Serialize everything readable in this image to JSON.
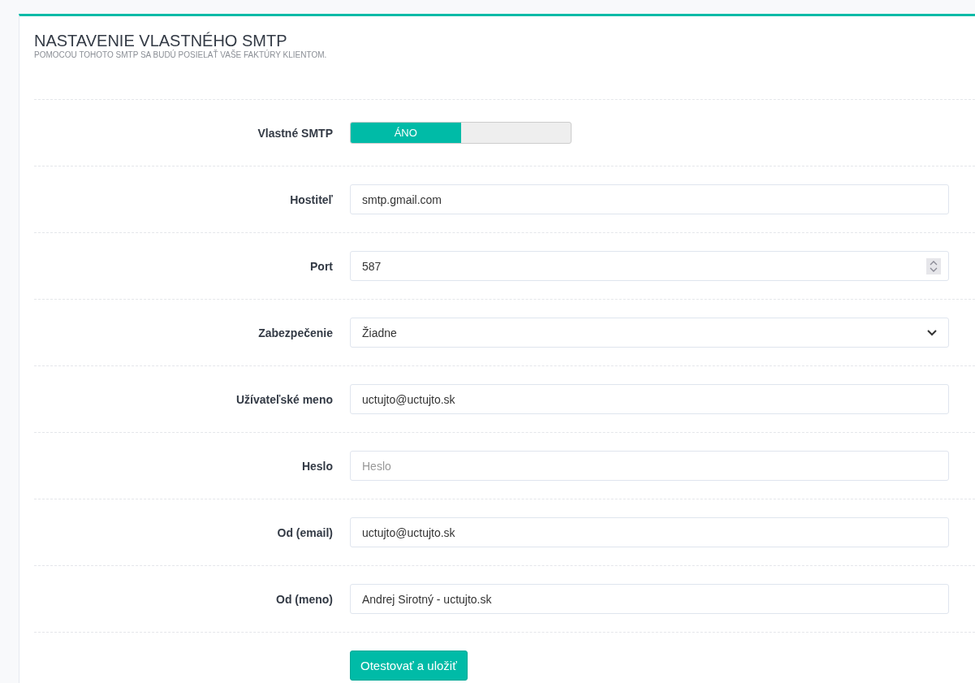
{
  "card": {
    "title": "NASTAVENIE VLASTNÉHO SMTP",
    "subtitle": "POMOCOU TOHOTO SMTP SA BUDÚ POSIELAŤ VAŠE FAKTÚRY KLIENTOM."
  },
  "fields": [
    {
      "kind": "toggle",
      "label": "Vlastné SMTP",
      "on": true,
      "on_label": "ÁNO"
    },
    {
      "kind": "text",
      "label": "Hostiteľ",
      "value": "smtp.gmail.com"
    },
    {
      "kind": "number",
      "label": "Port",
      "value": "587"
    },
    {
      "kind": "select",
      "label": "Zabezpečenie",
      "value": "Žiadne"
    },
    {
      "kind": "text",
      "label": "Užívateľské meno",
      "value": "uctujto@uctujto.sk"
    },
    {
      "kind": "password",
      "label": "Heslo",
      "placeholder": "Heslo"
    },
    {
      "kind": "text",
      "label": "Od (email)",
      "value": "uctujto@uctujto.sk"
    },
    {
      "kind": "text",
      "label": "Od (meno)",
      "value": "Andrej Sirotný - uctujto.sk"
    }
  ],
  "submit_button": "Otestovať a uložiť"
}
